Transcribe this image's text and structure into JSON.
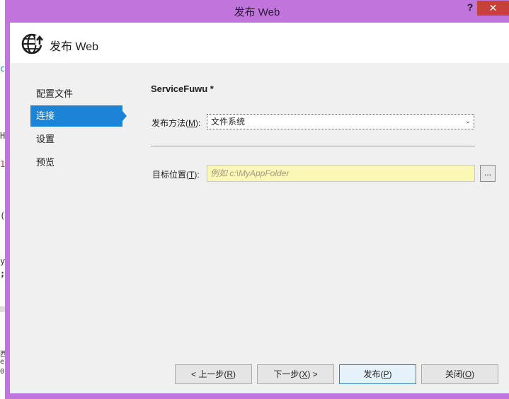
{
  "window": {
    "title": "发布 Web",
    "help": "?",
    "close": "✕"
  },
  "header": {
    "title": "发布 Web",
    "icon": "globe-publish-icon"
  },
  "nav": {
    "items": [
      {
        "label": "配置文件"
      },
      {
        "label": "连接"
      },
      {
        "label": "设置"
      },
      {
        "label": "预览"
      }
    ],
    "active_index": 1
  },
  "profile": {
    "name": "ServiceFuwu *"
  },
  "form": {
    "method_label_prefix": "发布方法(",
    "method_label_key": "M",
    "method_label_suffix": "):",
    "method_value": "文件系统",
    "target_label_prefix": "目标位置(",
    "target_label_key": "T",
    "target_label_suffix": "):",
    "target_placeholder": "例如 c:\\MyAppFolder",
    "browse_label": "..."
  },
  "buttons": {
    "prev_prefix": "< 上一步(",
    "prev_key": "R",
    "prev_suffix": ")",
    "next_prefix": "下一步(",
    "next_key": "X",
    "next_suffix": ") >",
    "publish_prefix": "发布(",
    "publish_key": "P",
    "publish_suffix": ")",
    "close_prefix": "关闭(",
    "close_key": "O",
    "close_suffix": ")"
  },
  "background_editor": {
    "fragments": [
      "c",
      "H",
      "1",
      "(",
      "y",
      ";",
      "西",
      "el",
      "0"
    ]
  },
  "colors": {
    "frame": "#c074dc",
    "close_button": "#c7413c",
    "accent": "#1c84d6",
    "input_highlight": "#fbf7b5"
  }
}
